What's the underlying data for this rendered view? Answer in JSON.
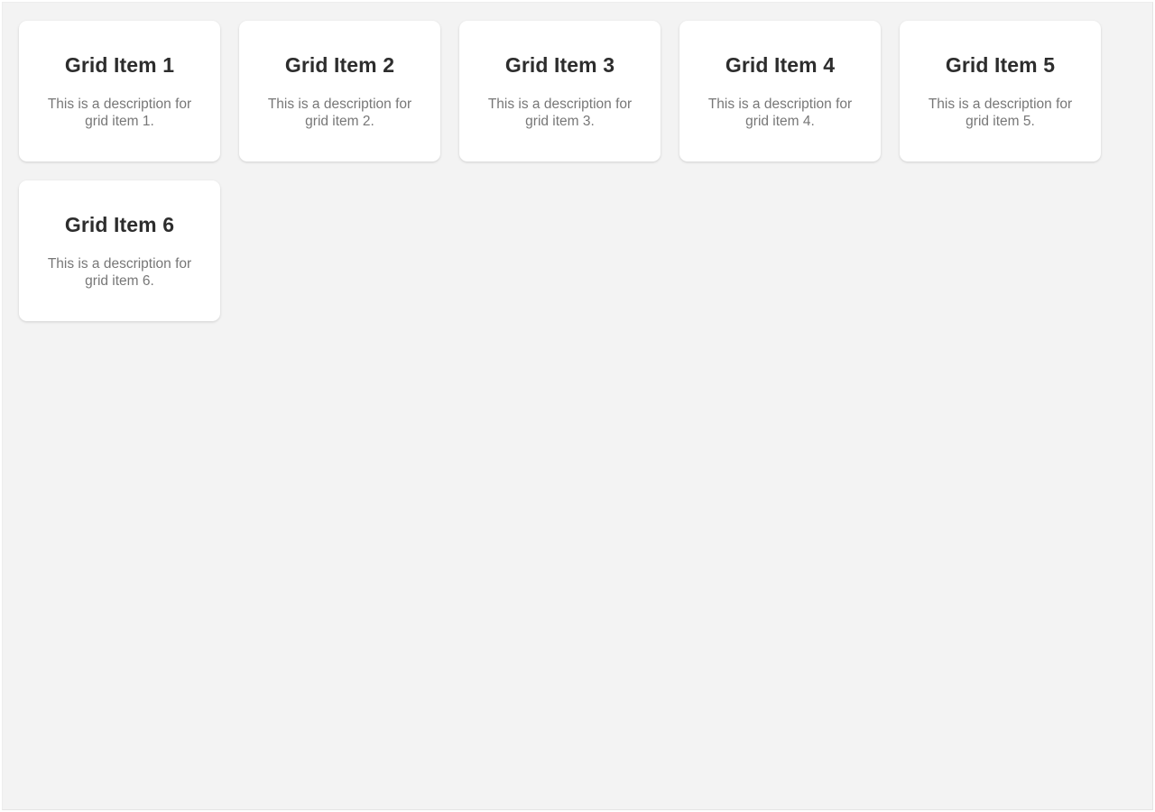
{
  "page": {
    "background_color": "#f3f3f3",
    "frame_border_color": "#e4e4e4"
  },
  "grid": {
    "card_background": "#ffffff",
    "title_color": "#2d2d2d",
    "description_color": "#777777",
    "items": [
      {
        "title": "Grid Item 1",
        "description": "This is a description for grid item 1."
      },
      {
        "title": "Grid Item 2",
        "description": "This is a description for grid item 2."
      },
      {
        "title": "Grid Item 3",
        "description": "This is a description for grid item 3."
      },
      {
        "title": "Grid Item 4",
        "description": "This is a description for grid item 4."
      },
      {
        "title": "Grid Item 5",
        "description": "This is a description for grid item 5."
      },
      {
        "title": "Grid Item 6",
        "description": "This is a description for grid item 6."
      }
    ]
  }
}
